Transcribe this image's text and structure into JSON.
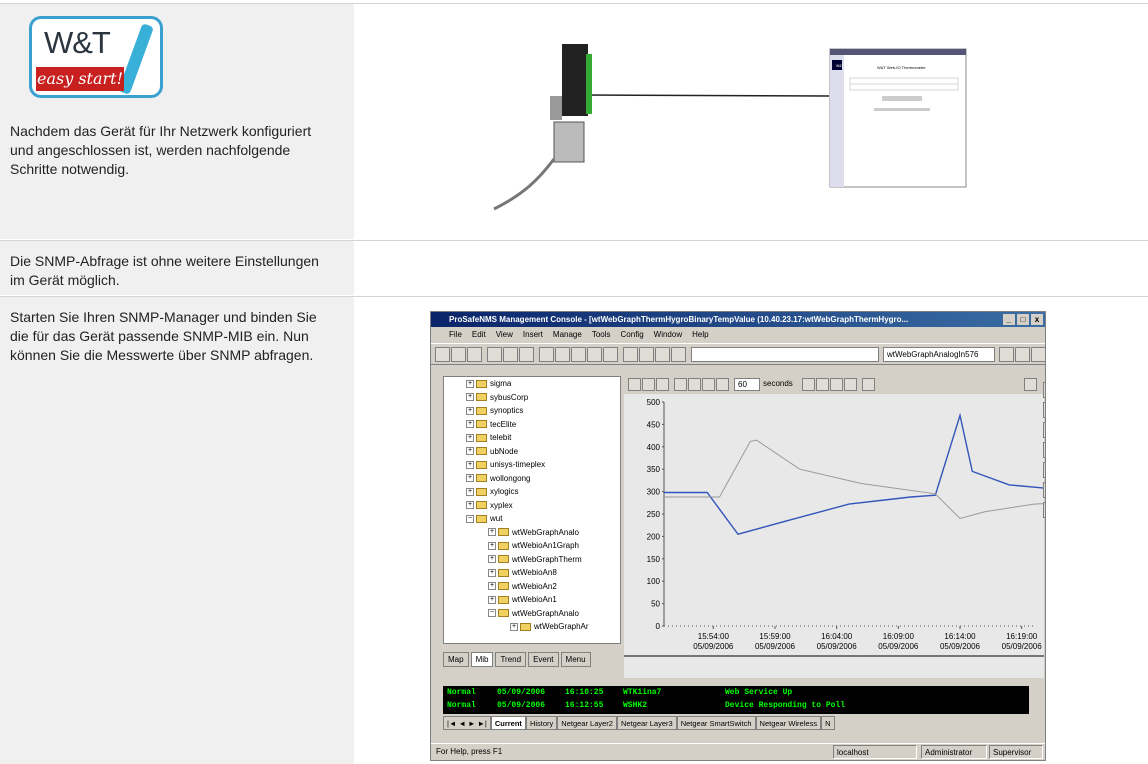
{
  "logo": {
    "brand": "W&T",
    "tagline": "easy start!"
  },
  "rows": [
    {
      "text": "Nachdem das Gerät für Ihr Netzwerk konfiguriert und angeschlossen ist, werden nachfolgende Schritte notwendig."
    },
    {
      "text": "Die SNMP-Abfrage ist ohne weitere Einstellungen im Gerät möglich."
    },
    {
      "text": "Starten Sie Ihren SNMP-Manager und binden Sie die für das Gerät passende SNMP-MIB ein. Nun können Sie die Messwerte über SNMP abfragen."
    }
  ],
  "illustration": {
    "page_title": "W&T Web-IO Thermometer",
    "logo": "W&T"
  },
  "app": {
    "title": "ProSafeNMS Management Console - [wtWebGraphThermHygroBinaryTempValue (10.40.23.17:wtWebGraphThermHygro...",
    "menu": [
      "File",
      "Edit",
      "View",
      "Insert",
      "Manage",
      "Tools",
      "Config",
      "Window",
      "Help"
    ],
    "toolbar": {
      "combo1": "",
      "combo2": "wtWebGraphAnalogIn576"
    },
    "tree": [
      {
        "label": "sigma",
        "exp": "+",
        "indent": 1
      },
      {
        "label": "sybusCorp",
        "exp": "+",
        "indent": 1
      },
      {
        "label": "synoptics",
        "exp": "+",
        "indent": 1
      },
      {
        "label": "tecElite",
        "exp": "+",
        "indent": 1
      },
      {
        "label": "telebit",
        "exp": "+",
        "indent": 1
      },
      {
        "label": "ubNode",
        "exp": "+",
        "indent": 1
      },
      {
        "label": "unisys-timeplex",
        "exp": "+",
        "indent": 1
      },
      {
        "label": "wollongong",
        "exp": "+",
        "indent": 1
      },
      {
        "label": "xylogics",
        "exp": "+",
        "indent": 1
      },
      {
        "label": "xyplex",
        "exp": "+",
        "indent": 1
      },
      {
        "label": "wut",
        "exp": "−",
        "indent": 1
      },
      {
        "label": "wtWebGraphAnalo",
        "exp": "+",
        "indent": 2
      },
      {
        "label": "wtWebioAn1Graph",
        "exp": "+",
        "indent": 2
      },
      {
        "label": "wtWebGraphTherm",
        "exp": "+",
        "indent": 2
      },
      {
        "label": "wtWebioAn8",
        "exp": "+",
        "indent": 2
      },
      {
        "label": "wtWebioAn2",
        "exp": "+",
        "indent": 2
      },
      {
        "label": "wtWebioAn1",
        "exp": "+",
        "indent": 2
      },
      {
        "label": "wtWebGraphAnalo",
        "exp": "−",
        "indent": 2
      },
      {
        "label": "wtWebGraphAr",
        "exp": "+",
        "indent": 3
      }
    ],
    "left_tabs": [
      "Map",
      "Mib",
      "Trend",
      "Event",
      "Menu"
    ],
    "graph_toolbar": {
      "interval": "60",
      "unit": "seconds"
    },
    "events": [
      {
        "status": "Normal",
        "date": "05/09/2006",
        "time": "16:10:25",
        "host": "WTK1ina7",
        "msg": "Web Service Up"
      },
      {
        "status": "Normal",
        "date": "05/09/2006",
        "time": "16:12:55",
        "host": "WSHK2",
        "msg": "Device Responding to Poll"
      }
    ],
    "event_tabs": [
      "Current",
      "History",
      "Netgear Layer2",
      "Netgear Layer3",
      "Netgear SmartSwitch",
      "Netgear Wireless",
      "N"
    ],
    "status": {
      "help": "For Help, press F1",
      "host": "localhost",
      "user": "Administrator",
      "role": "Supervisor"
    }
  },
  "chart_data": {
    "type": "line",
    "title": "",
    "xlabel": "",
    "ylabel": "",
    "ylim": [
      0,
      500
    ],
    "y_ticks": [
      0,
      50,
      100,
      150,
      200,
      250,
      300,
      350,
      400,
      450,
      500
    ],
    "x_tick_labels": [
      {
        "time": "15:54:00",
        "date": "05/09/2006"
      },
      {
        "time": "15:59:00",
        "date": "05/09/2006"
      },
      {
        "time": "16:04:00",
        "date": "05/09/2006"
      },
      {
        "time": "16:09:00",
        "date": "05/09/2006"
      },
      {
        "time": "16:14:00",
        "date": "05/09/2006"
      },
      {
        "time": "16:19:00",
        "date": "05/09/2006"
      }
    ],
    "x_minutes_range": [
      -4,
      26
    ],
    "series": [
      {
        "color": "#3355bb",
        "points": [
          [
            -4,
            298
          ],
          [
            -0.5,
            298
          ],
          [
            2,
            205
          ],
          [
            6,
            235
          ],
          [
            11,
            272
          ],
          [
            16,
            288
          ],
          [
            18,
            292
          ],
          [
            20,
            470
          ],
          [
            21,
            345
          ],
          [
            24,
            315
          ],
          [
            28,
            305
          ]
        ]
      },
      {
        "color": "#999999",
        "points": [
          [
            -4,
            288
          ],
          [
            0.5,
            288
          ],
          [
            3,
            412
          ],
          [
            3.5,
            415
          ],
          [
            7,
            350
          ],
          [
            12,
            318
          ],
          [
            18,
            295
          ],
          [
            20,
            240
          ],
          [
            22,
            255
          ],
          [
            26,
            272
          ],
          [
            28,
            275
          ]
        ]
      }
    ],
    "grid": false,
    "legend": "none"
  }
}
